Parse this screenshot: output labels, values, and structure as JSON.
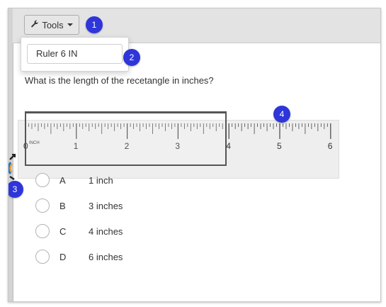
{
  "toolbar": {
    "tools_label": "Tools"
  },
  "dropdown": {
    "item_label": "Ruler 6 IN"
  },
  "badges": [
    "1",
    "2",
    "3",
    "4"
  ],
  "question": {
    "text": "What is the length of the recetangle in inches?"
  },
  "ruler": {
    "unit_label": "INCH",
    "major_labels": [
      "0",
      "1",
      "2",
      "3",
      "4",
      "5",
      "6"
    ]
  },
  "options": [
    {
      "letter": "A",
      "text": "1 inch"
    },
    {
      "letter": "B",
      "text": "3 inches"
    },
    {
      "letter": "C",
      "text": "4 inches"
    },
    {
      "letter": "D",
      "text": "6 inches"
    }
  ],
  "colors": {
    "badge": "#2e35d9",
    "toolbar": "#e3e3e3"
  },
  "icons": {
    "tools": "wrench-icon",
    "caret": "caret-down-icon",
    "rotate": "rotate-handle-icon"
  }
}
